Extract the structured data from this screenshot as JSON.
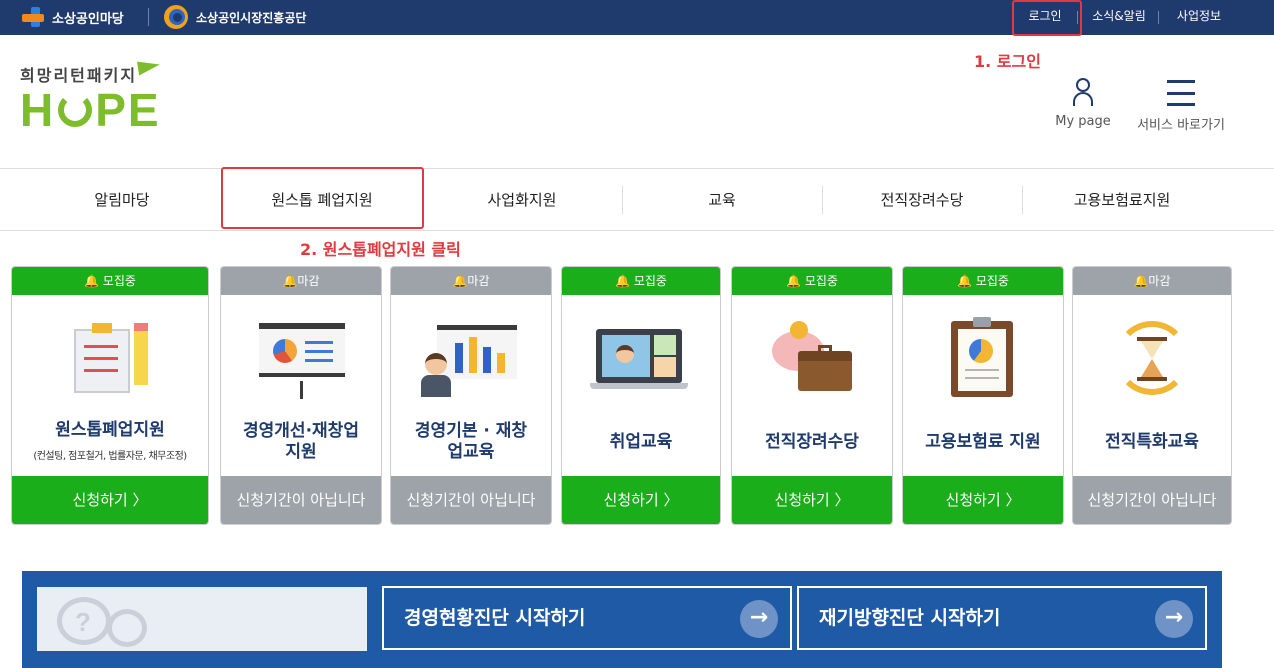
{
  "topbar": {
    "logo1": "소상공인마당",
    "logo2": "소상공인시장진흥공단",
    "links": [
      "로그인",
      "소식&알림",
      "사업정보"
    ]
  },
  "annotations": {
    "step1": "1. 로그인",
    "step2": "2. 원스톱폐업지원 클릭"
  },
  "brand": {
    "subtitle": "희망리턴패키지",
    "word_h": "H",
    "word_rest": "PE"
  },
  "header": {
    "mypage": "My page",
    "services": "서비스 바로가기"
  },
  "nav": {
    "items": [
      "알림마당",
      "원스톱 폐업지원",
      "사업화지원",
      "교육",
      "전직장려수당",
      "고용보험료지원"
    ]
  },
  "cards": [
    {
      "status": "모집중",
      "title": "원스톱폐업지원",
      "note": "(컨설팅, 점포철거, 법률자문, 채무조정)",
      "button": "신청하기 〉",
      "icon": "checklist-pencil-icon"
    },
    {
      "status": "마감",
      "title": "경영개선·재창업 지원",
      "note": "",
      "button": "신청기간이 아닙니다",
      "icon": "presentation-board-icon"
    },
    {
      "status": "마감",
      "title": "경영기본 · 재창업교육",
      "note": "",
      "button": "신청기간이 아닙니다",
      "icon": "lecture-chart-icon"
    },
    {
      "status": "모집중",
      "title": "취업교육",
      "note": "",
      "button": "신청하기 〉",
      "icon": "video-conference-icon"
    },
    {
      "status": "모집중",
      "title": "전직장려수당",
      "note": "",
      "button": "신청하기 〉",
      "icon": "piggybank-briefcase-icon"
    },
    {
      "status": "모집중",
      "title": "고용보험료 지원",
      "note": "",
      "button": "신청하기 〉",
      "icon": "clipboard-report-icon"
    },
    {
      "status": "마감",
      "title": "전직특화교육",
      "note": "",
      "button": "신청기간이 아닙니다",
      "icon": "hourglass-cycle-icon"
    }
  ],
  "banner": {
    "btn1": "경영현황진단 시작하기",
    "btn2": "재기방향진단 시작하기"
  },
  "colors": {
    "navy": "#1f3a6d",
    "green": "#1aaf1a",
    "gray": "#9da3a8",
    "brand_green": "#7dbc2b",
    "annotation_red": "#e0393e"
  }
}
